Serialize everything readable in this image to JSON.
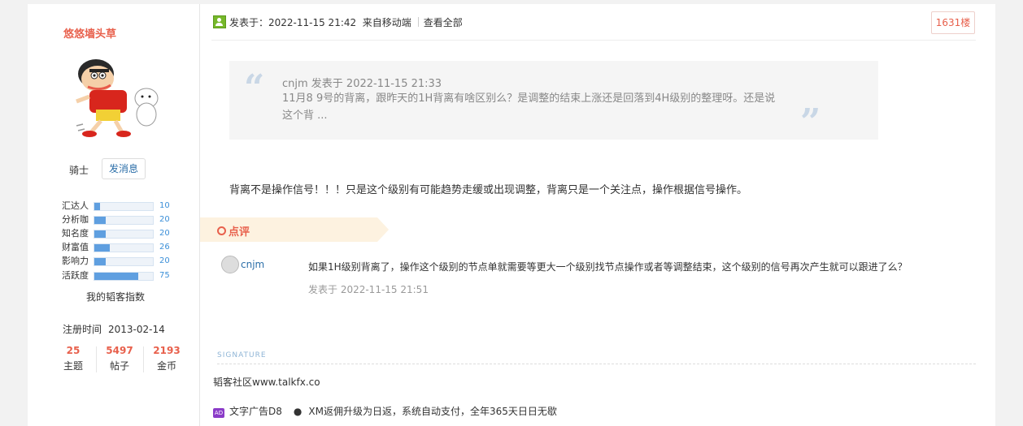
{
  "user": {
    "name": "悠悠墙头草",
    "role": "骑士",
    "message_button": "发消息",
    "stats": [
      {
        "label": "汇达人",
        "value": "10",
        "level": 0.1
      },
      {
        "label": "分析咖",
        "value": "20",
        "level": 0.2
      },
      {
        "label": "知名度",
        "value": "20",
        "level": 0.2
      },
      {
        "label": "财富值",
        "value": "26",
        "level": 0.26
      },
      {
        "label": "影响力",
        "value": "20",
        "level": 0.2
      },
      {
        "label": "活跃度",
        "value": "75",
        "level": 0.75
      }
    ],
    "index_label": "我的韬客指数",
    "register_label": "注册时间",
    "register_date": "2013-02-14",
    "counts": [
      {
        "number": "25",
        "label": "主题"
      },
      {
        "number": "5497",
        "label": "帖子"
      },
      {
        "number": "2193",
        "label": "金币"
      }
    ]
  },
  "post": {
    "posted_label": "发表于：2022-11-15 21:42",
    "source": "来自移动端",
    "view_all": "查看全部",
    "floor": "1631楼",
    "quote": {
      "header": "cnjm 发表于 2022-11-15 21:33",
      "text": "11月8 9号的背离，跟昨天的1H背离有啥区别么？是调整的结束上涨还是回落到4H级别的整理呀。还是说这个背 ..."
    },
    "body": "背离不是操作信号！！！只是这个级别有可能趋势走缓或出现调整，背离只是一个关注点，操作根据信号操作。",
    "comment_section": "点评",
    "comment": {
      "author": "cnjm",
      "text": "如果1H级别背离了，操作这个级别的节点单就需要等更大一个级别找节点操作或者等调整结束，这个级别的信号再次产生就可以跟进了么？",
      "time": "发表于 2022-11-15 21:51"
    },
    "signature_label": "SIGNATURE",
    "signature": "韬客社区www.talkfx.co",
    "ad_icon": "AD",
    "ad_title": "文字广告D8",
    "ad_text": "XM返佣升级为日返，系统自动支付，全年365天日日无歇"
  }
}
